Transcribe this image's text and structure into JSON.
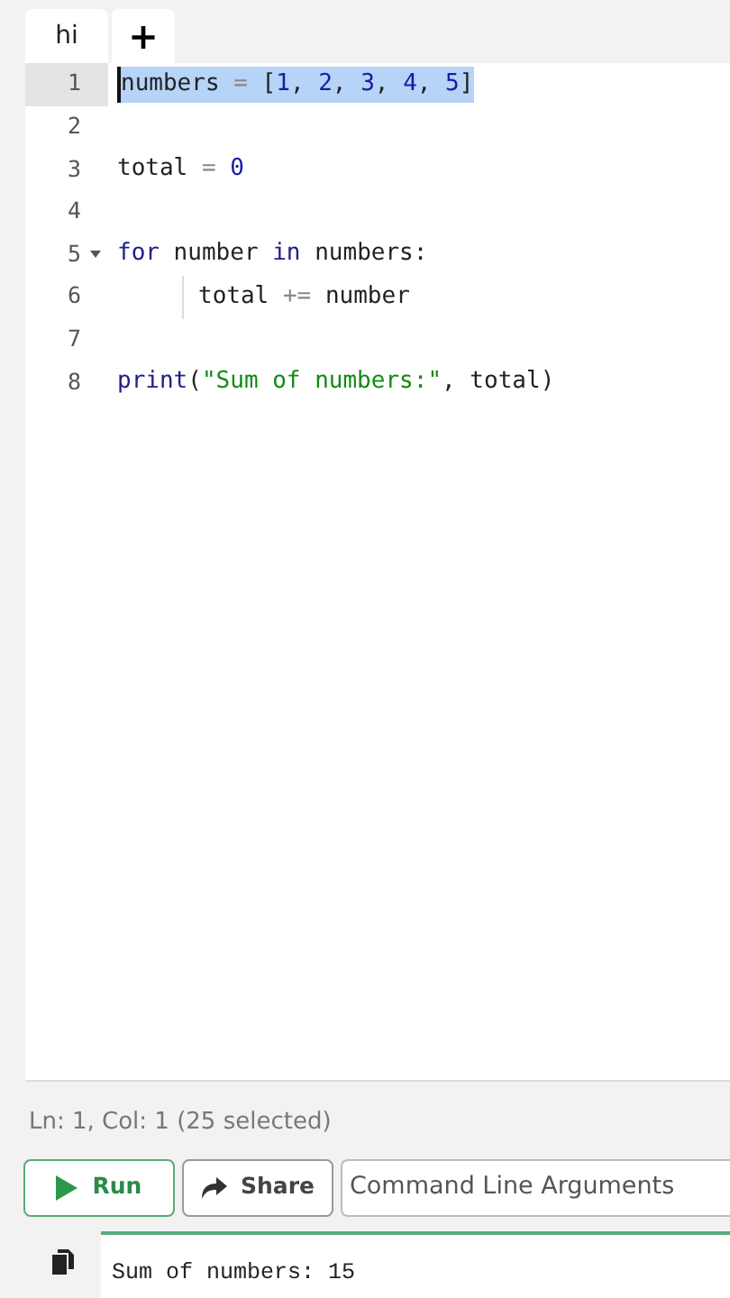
{
  "tabs": [
    {
      "label": "hi",
      "selected": true
    }
  ],
  "add_tab": "+",
  "editor": {
    "lines": [
      {
        "number": "1",
        "selected": true,
        "tokens": [
          {
            "kind": "plain",
            "text": "numbers"
          },
          {
            "kind": "op",
            "text": " = "
          },
          {
            "kind": "plain",
            "text": "["
          },
          {
            "kind": "num",
            "text": "1"
          },
          {
            "kind": "plain",
            "text": ", "
          },
          {
            "kind": "num",
            "text": "2"
          },
          {
            "kind": "plain",
            "text": ", "
          },
          {
            "kind": "num",
            "text": "3"
          },
          {
            "kind": "plain",
            "text": ", "
          },
          {
            "kind": "num",
            "text": "4"
          },
          {
            "kind": "plain",
            "text": ", "
          },
          {
            "kind": "num",
            "text": "5"
          },
          {
            "kind": "plain",
            "text": "]"
          }
        ]
      },
      {
        "number": "2",
        "selected": false
      },
      {
        "number": "3",
        "selected": false,
        "tokens": [
          {
            "kind": "plain",
            "text": "total"
          },
          {
            "kind": "op",
            "text": " = "
          },
          {
            "kind": "num",
            "text": "0"
          }
        ]
      },
      {
        "number": "4",
        "selected": false
      },
      {
        "number": "5",
        "selected": false,
        "expanded": true,
        "tokens": [
          {
            "kind": "kw",
            "text": "for"
          },
          {
            "kind": "plain",
            "text": " number "
          },
          {
            "kind": "kw",
            "text": "in"
          },
          {
            "kind": "plain",
            "text": " numbers:"
          }
        ],
        "children": [
          {
            "number": "6",
            "selected": false,
            "tokens": [
              {
                "kind": "plain",
                "text": "total"
              },
              {
                "kind": "op",
                "text": " += "
              },
              {
                "kind": "plain",
                "text": "number"
              }
            ]
          }
        ]
      },
      {
        "number": "7",
        "selected": false
      },
      {
        "number": "8",
        "selected": false,
        "tokens": [
          {
            "kind": "kw",
            "text": "print"
          },
          {
            "kind": "plain",
            "text": "("
          },
          {
            "kind": "str",
            "text": "\"Sum of numbers:\""
          },
          {
            "kind": "plain",
            "text": ", total)"
          }
        ]
      }
    ]
  },
  "status_bar": "Ln: 1,  Col: 1 (25 selected)",
  "run_button": "Run",
  "share_button": "Share",
  "arguments_field": {
    "placeholder": "Command Line Arguments"
  },
  "output": "Sum of numbers: 15"
}
